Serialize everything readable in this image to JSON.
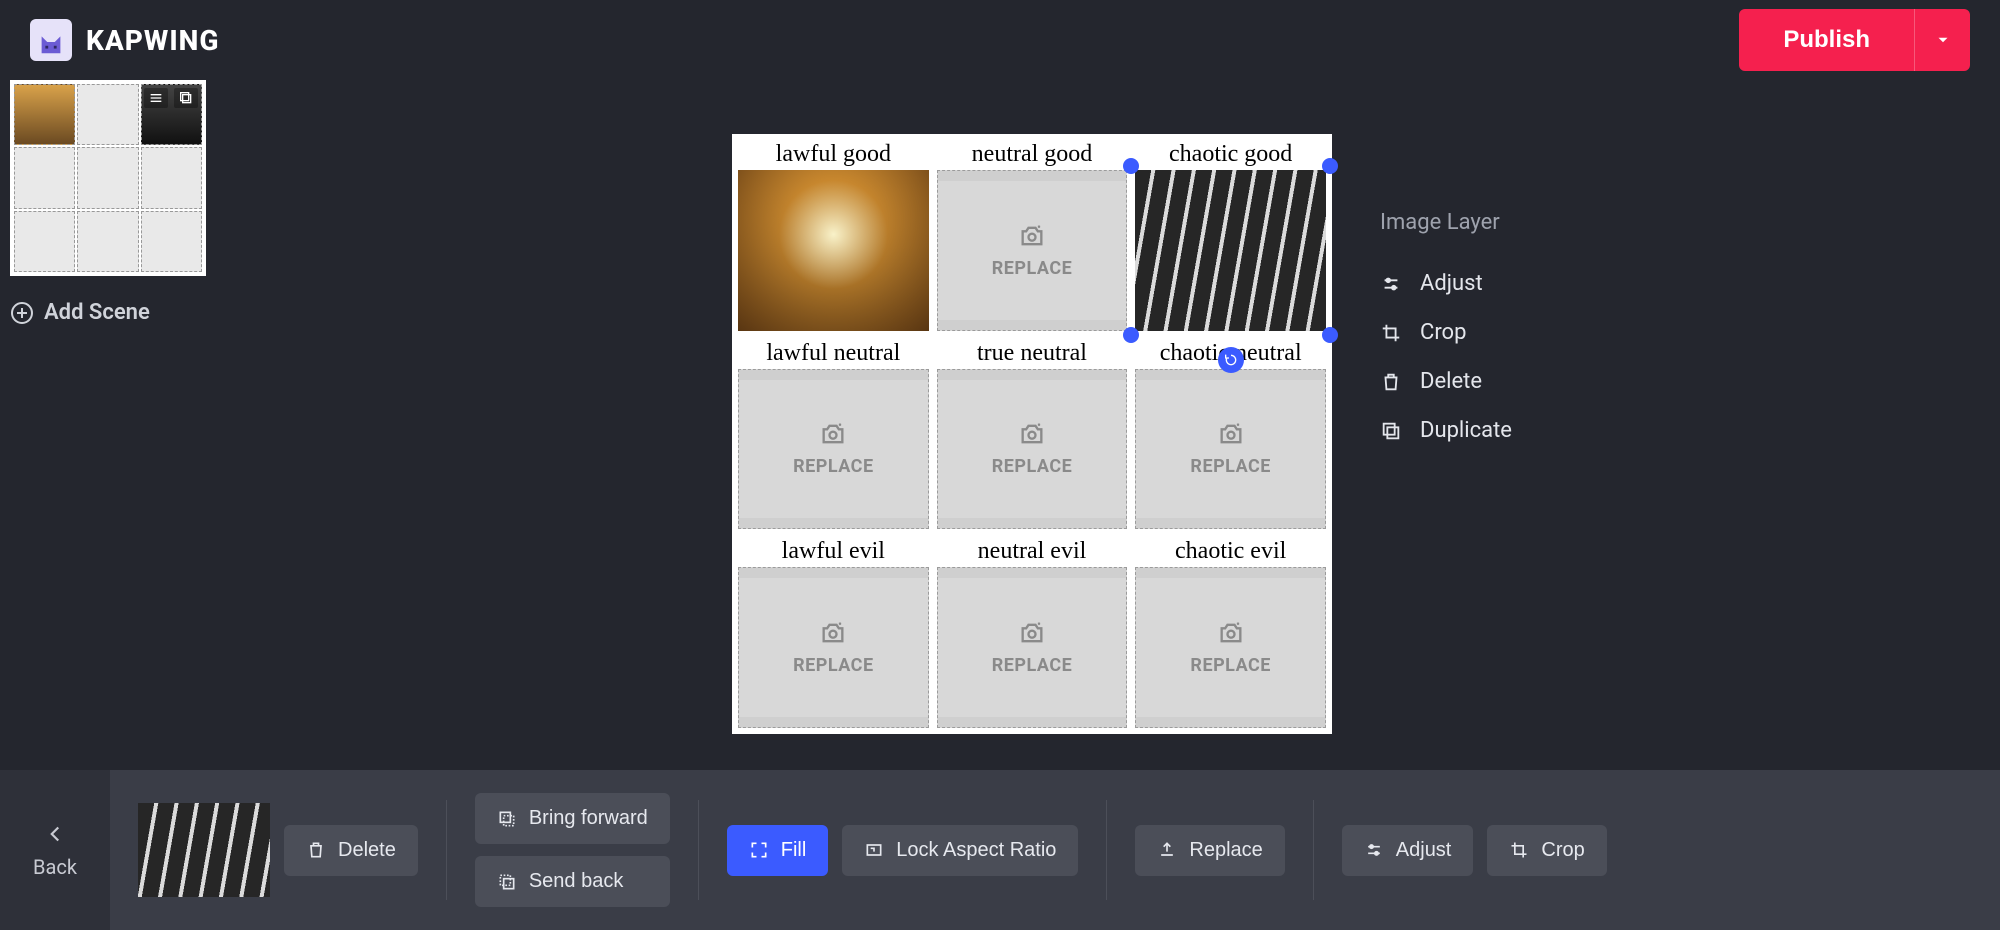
{
  "brand": {
    "name": "KAPWING"
  },
  "header": {
    "publish_label": "Publish"
  },
  "left": {
    "add_scene_label": "Add Scene"
  },
  "alignments": {
    "cells": [
      {
        "label": "lawful good",
        "kind": "image1"
      },
      {
        "label": "neutral good",
        "kind": "replace"
      },
      {
        "label": "chaotic good",
        "kind": "image2",
        "selected": true
      },
      {
        "label": "lawful neutral",
        "kind": "replace"
      },
      {
        "label": "true neutral",
        "kind": "replace"
      },
      {
        "label": "chaotic neutral",
        "kind": "replace"
      },
      {
        "label": "lawful evil",
        "kind": "replace"
      },
      {
        "label": "neutral evil",
        "kind": "replace"
      },
      {
        "label": "chaotic evil",
        "kind": "replace"
      }
    ],
    "replace_text": "REPLACE"
  },
  "right_panel": {
    "title": "Image Layer",
    "items": [
      {
        "label": "Adjust",
        "icon": "adjust-icon"
      },
      {
        "label": "Crop",
        "icon": "crop-icon"
      },
      {
        "label": "Delete",
        "icon": "trash-icon"
      },
      {
        "label": "Duplicate",
        "icon": "duplicate-icon"
      }
    ]
  },
  "bottom": {
    "back_label": "Back",
    "delete_label": "Delete",
    "bring_forward_label": "Bring forward",
    "send_back_label": "Send back",
    "fill_label": "Fill",
    "lock_aspect_label": "Lock Aspect Ratio",
    "replace_label": "Replace",
    "adjust_label": "Adjust",
    "crop_label": "Crop"
  }
}
